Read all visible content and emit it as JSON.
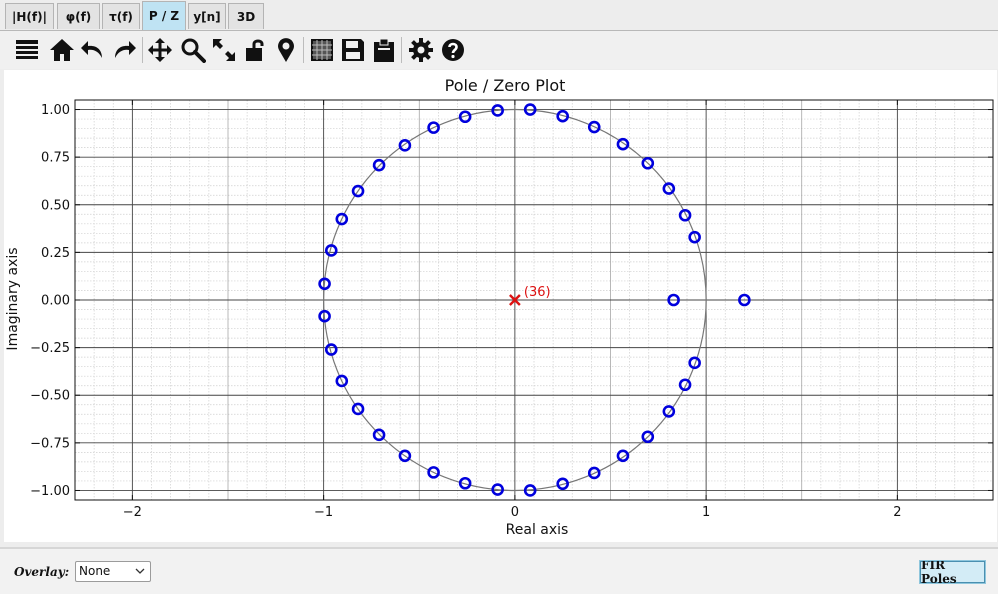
{
  "tabs": [
    {
      "label": "|H(f)|"
    },
    {
      "label": "φ(f)"
    },
    {
      "label": "τ(f)"
    },
    {
      "label": "P / Z"
    },
    {
      "label": "y[n]"
    },
    {
      "label": "3D"
    }
  ],
  "toolbar": {
    "icons": [
      "hamburger-menu-icon",
      "home-icon",
      "undo-icon",
      "redo-icon",
      "pan-icon",
      "zoom-icon",
      "fit-view-icon",
      "lock-icon",
      "marker-icon",
      "grid-icon",
      "save-icon",
      "clipboard-icon",
      "settings-icon",
      "help-icon"
    ]
  },
  "overlay": {
    "label": "Overlay:",
    "value": "None"
  },
  "fir_poles": {
    "label": "FIR Poles"
  },
  "chart_data": {
    "type": "scatter",
    "title": "Pole / Zero Plot",
    "xlabel": "Real axis",
    "ylabel": "Imaginary axis",
    "xlim": [
      -2.3,
      2.5
    ],
    "ylim": [
      -1.05,
      1.05
    ],
    "xticks": [
      -2,
      -1,
      0,
      1,
      2
    ],
    "xtick_labels": [
      "−2",
      "−1",
      "0",
      "1",
      "2"
    ],
    "yticks": [
      1.0,
      0.75,
      0.5,
      0.25,
      0.0,
      -0.25,
      -0.5,
      -0.75,
      -1.0
    ],
    "ytick_labels": [
      "1.00",
      "0.75",
      "0.50",
      "0.25",
      "0.00",
      "−0.25",
      "−0.50",
      "−0.75",
      "−1.00"
    ],
    "grid": true,
    "unit_circle": true,
    "zero_color": "#0000dd",
    "pole_color": "#dd1111",
    "zeros": [
      {
        "x": 0.08,
        "y": 1.0
      },
      {
        "x": 0.25,
        "y": 0.965
      },
      {
        "x": 0.415,
        "y": 0.908
      },
      {
        "x": 0.565,
        "y": 0.818
      },
      {
        "x": 0.695,
        "y": 0.718
      },
      {
        "x": 0.805,
        "y": 0.585
      },
      {
        "x": 0.89,
        "y": 0.445
      },
      {
        "x": 0.94,
        "y": 0.33
      },
      {
        "x": 0.83,
        "y": 0.0
      },
      {
        "x": 1.2,
        "y": 0.0
      },
      {
        "x": 0.94,
        "y": -0.33
      },
      {
        "x": 0.89,
        "y": -0.445
      },
      {
        "x": 0.805,
        "y": -0.585
      },
      {
        "x": 0.695,
        "y": -0.718
      },
      {
        "x": 0.565,
        "y": -0.818
      },
      {
        "x": 0.415,
        "y": -0.908
      },
      {
        "x": 0.25,
        "y": -0.965
      },
      {
        "x": 0.08,
        "y": -1.0
      },
      {
        "x": -0.09,
        "y": 0.995
      },
      {
        "x": -0.26,
        "y": 0.962
      },
      {
        "x": -0.425,
        "y": 0.905
      },
      {
        "x": -0.575,
        "y": 0.812
      },
      {
        "x": -0.71,
        "y": 0.708
      },
      {
        "x": -0.82,
        "y": 0.572
      },
      {
        "x": -0.905,
        "y": 0.425
      },
      {
        "x": -0.96,
        "y": 0.26
      },
      {
        "x": -0.995,
        "y": 0.085
      },
      {
        "x": -0.995,
        "y": -0.085
      },
      {
        "x": -0.96,
        "y": -0.26
      },
      {
        "x": -0.905,
        "y": -0.425
      },
      {
        "x": -0.82,
        "y": -0.572
      },
      {
        "x": -0.71,
        "y": -0.708
      },
      {
        "x": -0.575,
        "y": -0.818
      },
      {
        "x": -0.425,
        "y": -0.905
      },
      {
        "x": -0.26,
        "y": -0.962
      },
      {
        "x": -0.09,
        "y": -0.995
      }
    ],
    "poles": [
      {
        "x": 0.0,
        "y": 0.0,
        "label": "(36)"
      }
    ]
  }
}
